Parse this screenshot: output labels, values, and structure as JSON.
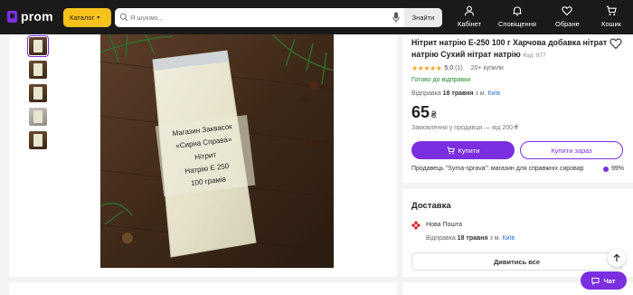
{
  "header": {
    "logo_text": "prom",
    "catalog_label": "Каталог",
    "search_placeholder": "Я шукаю...",
    "search_button": "Знайти",
    "nav": [
      {
        "label": "Кабінет",
        "icon": "user-icon"
      },
      {
        "label": "Сповіщення",
        "icon": "bell-icon"
      },
      {
        "label": "Обране",
        "icon": "heart-icon"
      },
      {
        "label": "Кошик",
        "icon": "cart-icon"
      }
    ]
  },
  "gallery": {
    "photo_text": {
      "shop_line": "Магазин  Заквасок",
      "brand_line": "«Сирна Справа»",
      "product_line1": "Нітрит",
      "product_line2": "Натрію Е 250",
      "product_line3": "100 грамів"
    }
  },
  "product": {
    "title": "Нітрит натрію Е-250 100 г Харчова добавка нітрат натрію Сухий нітрат натрію",
    "code": "Код: 977",
    "rating": 5,
    "rating_text": "5.0",
    "rating_count": "(1)",
    "purchases": "20+ купили",
    "availability": "Готово до відправки",
    "dispatch_prefix": "Відправка",
    "dispatch_date": "18 травня",
    "dispatch_mid": "з м.",
    "dispatch_city": "Київ",
    "price": "65",
    "currency": "₴",
    "min_order": "Замовлення у продавця — від 200 ₴",
    "buy_label": "Купити",
    "buy_now_label": "Купити зараз",
    "seller": "Продавець \"Syma-sprava\": магазин для справжніх сировар",
    "seller_score": "99%"
  },
  "delivery": {
    "title": "Доставка",
    "carrier": "Нова Пошта",
    "dispatch_prefix": "Відправка",
    "dispatch_date": "18 травня",
    "dispatch_mid": "з м.",
    "dispatch_city": "Київ",
    "view_all": "Дивитись все"
  },
  "chat": {
    "label": "Чат"
  },
  "colors": {
    "brand_purple": "#7b2fe0",
    "header_bg": "#1a1a1a",
    "catalog_yellow": "#f7c21a",
    "ready_green": "#1d8a2b",
    "link_blue": "#2f6fd6",
    "star_orange": "#f5a623"
  }
}
